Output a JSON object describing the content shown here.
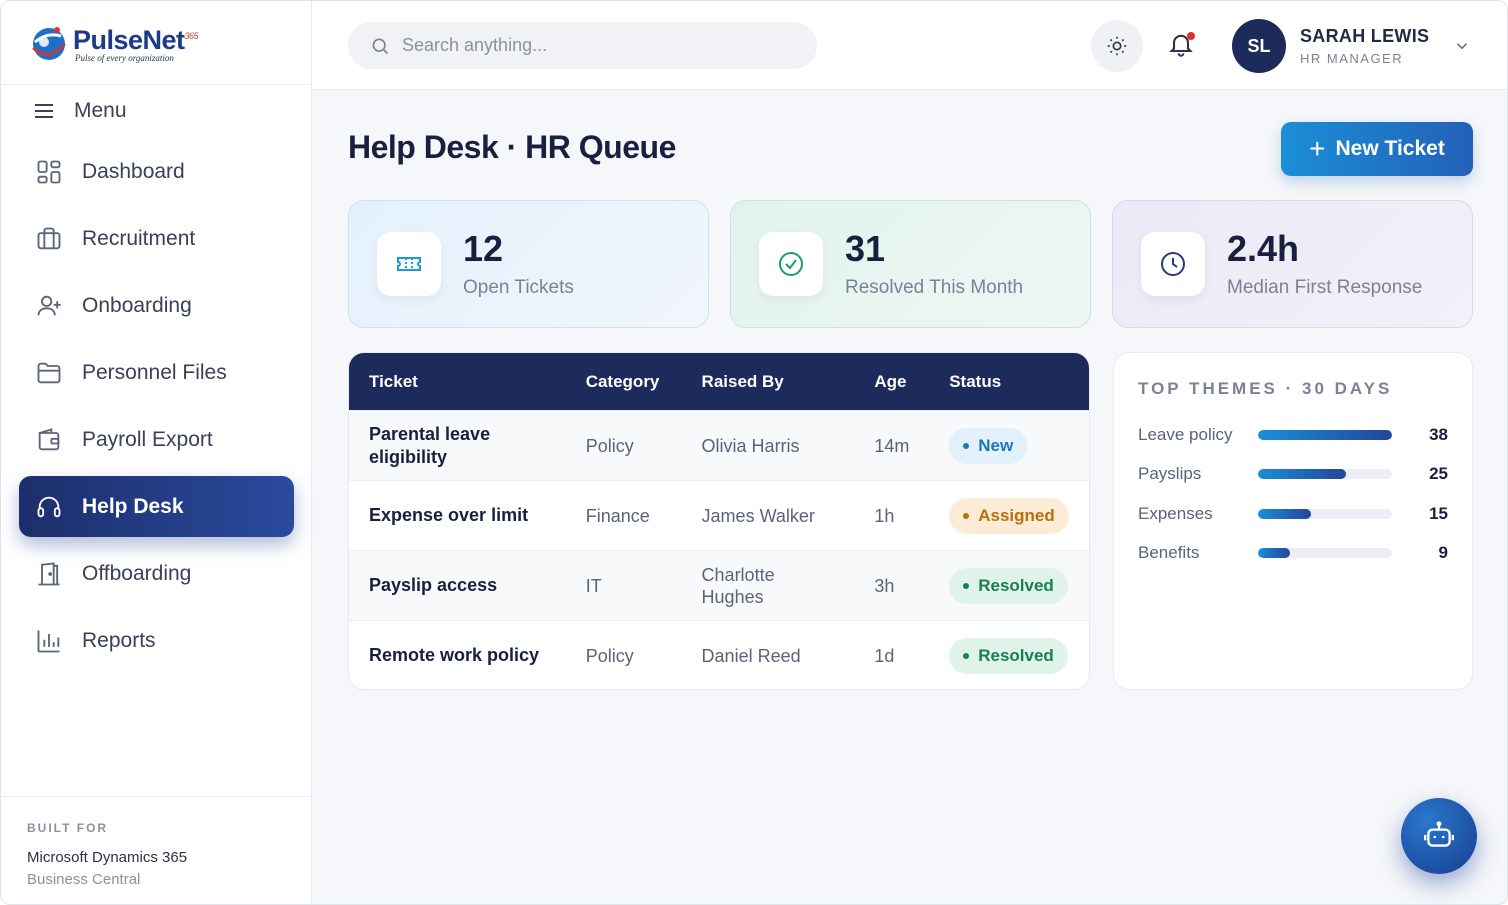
{
  "brand": {
    "name": "PulseNet",
    "suffix": "365",
    "tagline": "Pulse of every organization"
  },
  "sidebar": {
    "menu_label": "Menu",
    "items": [
      {
        "label": "Dashboard",
        "icon": "grid-icon"
      },
      {
        "label": "Recruitment",
        "icon": "briefcase-icon"
      },
      {
        "label": "Onboarding",
        "icon": "user-plus-icon"
      },
      {
        "label": "Personnel Files",
        "icon": "folder-icon"
      },
      {
        "label": "Payroll Export",
        "icon": "wallet-icon"
      },
      {
        "label": "Help Desk",
        "icon": "headset-icon",
        "active": true
      },
      {
        "label": "Offboarding",
        "icon": "door-icon"
      },
      {
        "label": "Reports",
        "icon": "bar-chart-icon"
      }
    ],
    "built_for": {
      "kicker": "BUILT FOR",
      "product": "Microsoft Dynamics 365",
      "edition": "Business Central"
    }
  },
  "topbar": {
    "search_placeholder": "Search anything...",
    "user": {
      "initials": "SL",
      "name": "SARAH LEWIS",
      "role": "HR MANAGER"
    }
  },
  "page": {
    "title": "Help Desk · HR Queue",
    "new_ticket_label": "New Ticket"
  },
  "stats": [
    {
      "value": "12",
      "label": "Open Tickets",
      "icon": "ticket-icon",
      "color": "#1a9ad6"
    },
    {
      "value": "31",
      "label": "Resolved This Month",
      "icon": "check-circle-icon",
      "color": "#1f9a6a"
    },
    {
      "value": "2.4h",
      "label": "Median First Response",
      "icon": "clock-icon",
      "color": "#2a3a7a"
    }
  ],
  "table": {
    "headers": [
      "Ticket",
      "Category",
      "Raised By",
      "Age",
      "Status"
    ],
    "rows": [
      {
        "ticket": "Parental leave eligibility",
        "category": "Policy",
        "raised_by": "Olivia Harris",
        "age": "14m",
        "status": "New"
      },
      {
        "ticket": "Expense over limit",
        "category": "Finance",
        "raised_by": "James Walker",
        "age": "1h",
        "status": "Assigned"
      },
      {
        "ticket": "Payslip access",
        "category": "IT",
        "raised_by": "Charlotte Hughes",
        "age": "3h",
        "status": "Resolved"
      },
      {
        "ticket": "Remote work policy",
        "category": "Policy",
        "raised_by": "Daniel Reed",
        "age": "1d",
        "status": "Resolved"
      }
    ]
  },
  "themes": {
    "title": "TOP THEMES · 30 DAYS",
    "items": [
      {
        "label": "Leave policy",
        "value": 38
      },
      {
        "label": "Payslips",
        "value": 25
      },
      {
        "label": "Expenses",
        "value": 15
      },
      {
        "label": "Benefits",
        "value": 9
      }
    ]
  },
  "colors": {
    "accent": "#1c2a5c",
    "primary_button": "#1b8fd6",
    "alert_dot": "#e02d2d"
  }
}
